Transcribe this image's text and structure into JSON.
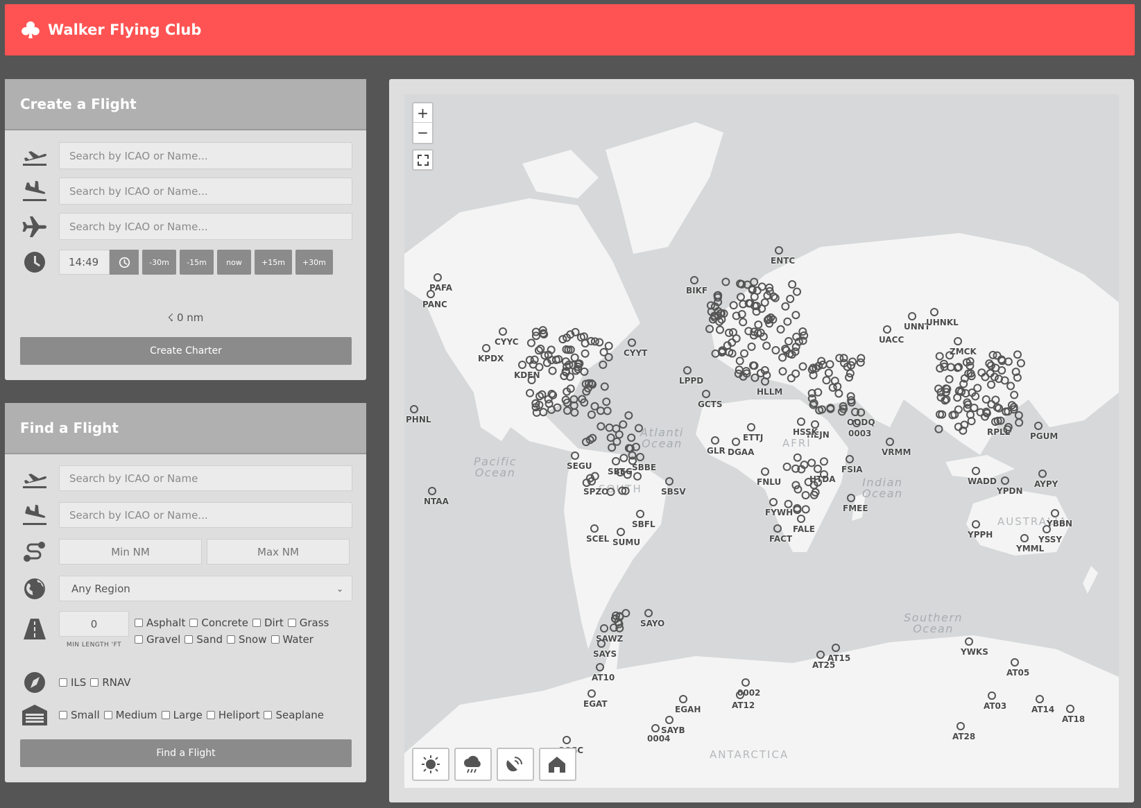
{
  "header": {
    "title": "Walker Flying Club",
    "logo_icon": "club-icon"
  },
  "create_flight": {
    "title": "Create a Flight",
    "departure_placeholder": "Search by ICAO or Name...",
    "arrival_placeholder": "Search by ICAO or Name...",
    "aircraft_placeholder": "Search by ICAO or Name...",
    "time_value": "14:49",
    "time_buttons": [
      "-30m",
      "-15m",
      "now",
      "+15m",
      "+30m"
    ],
    "distance": "0 nm",
    "submit_label": "Create Charter"
  },
  "find_flight": {
    "title": "Find a Flight",
    "departure_placeholder": "Search by ICAO or Name",
    "arrival_placeholder": "Search by ICAO or Name...",
    "min_nm_placeholder": "Min NM",
    "max_nm_placeholder": "Max NM",
    "region_selected": "Any Region",
    "min_length_value": "0",
    "min_length_label": "MIN LENGTH 'FT",
    "surfaces_row1": [
      "Asphalt",
      "Concrete",
      "Dirt",
      "Grass"
    ],
    "surfaces_row2": [
      "Gravel",
      "Sand",
      "Snow",
      "Water"
    ],
    "approaches": [
      "ILS",
      "RNAV"
    ],
    "sizes": [
      "Small",
      "Medium",
      "Large",
      "Heliport",
      "Seaplane"
    ],
    "submit_label": "Find a Flight"
  },
  "map": {
    "zoom_in": "+",
    "zoom_out": "−",
    "oceans": {
      "pacific": "Pacific\nOcean",
      "atlantic": "Atlanti\nOcean",
      "indian": "Indian\nOcean",
      "southern": "Southern\nOcean"
    },
    "continents": {
      "antarctica": "ANTARCTICA",
      "australia": "AUSTRALIA",
      "south_america": "SOUTH",
      "africa": "AFRI"
    },
    "airports": [
      "ENTC",
      "BIKF",
      "PAFA",
      "PANC",
      "PHNL",
      "NTAA",
      "CYYT",
      "CYYC",
      "KPDX",
      "KDEN",
      "LPPD",
      "GCTS",
      "SBEG",
      "SBBE",
      "SBSV",
      "SBFL",
      "SCEL",
      "SUMU",
      "SEGU",
      "SPZO",
      "SAYO",
      "SAWZ",
      "SAYS",
      "AT10",
      "EGAT",
      "EGAH",
      "SAYB",
      "0004",
      "SCGC",
      "AT12",
      "0002",
      "AT25",
      "AT15",
      "YWKS",
      "AT05",
      "AT03",
      "AT14",
      "AT18",
      "AT28",
      "UNNT",
      "UHNKL",
      "UACC",
      "ZMCK",
      "PGUM",
      "YPDN",
      "YPPH",
      "YBBN",
      "YSSY",
      "YMML",
      "AYPY",
      "FACT",
      "FALE",
      "FMEE",
      "FSIA",
      "HTDA",
      "FNLU",
      "HLLM",
      "HEJN",
      "OODQ",
      "0003",
      "VRMM",
      "WADD",
      "DGAA",
      "GLR",
      "ETTJ",
      "HSSK",
      "FYWH",
      "RPLL"
    ]
  }
}
